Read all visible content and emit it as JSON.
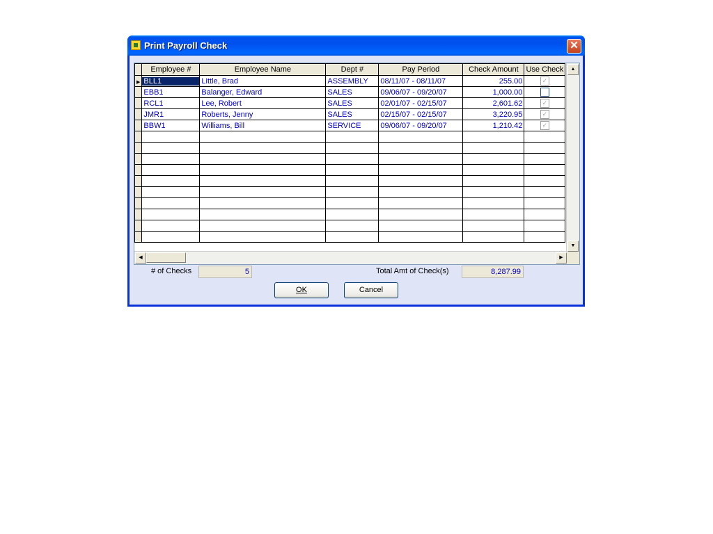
{
  "window": {
    "title": "Print Payroll Check",
    "close_symbol": "✕"
  },
  "grid": {
    "columns": [
      "Employee #",
      "Employee Name",
      "Dept #",
      "Pay Period",
      "Check Amount",
      "Use Check"
    ],
    "rows": [
      {
        "emp": "BLL1",
        "name": "Little, Brad",
        "dept": "ASSEMBLY",
        "period": "08/11/07 - 08/11/07",
        "amount": "255.00",
        "use": true
      },
      {
        "emp": "EBB1",
        "name": "Balanger, Edward",
        "dept": "SALES",
        "period": "09/06/07 - 09/20/07",
        "amount": "1,000.00",
        "use": false
      },
      {
        "emp": "RCL1",
        "name": "Lee, Robert",
        "dept": "SALES",
        "period": "02/01/07 - 02/15/07",
        "amount": "2,601.62",
        "use": true
      },
      {
        "emp": "JMR1",
        "name": "Roberts, Jenny",
        "dept": "SALES",
        "period": "02/15/07 - 02/15/07",
        "amount": "3,220.95",
        "use": true
      },
      {
        "emp": "BBW1",
        "name": "Williams, Bill",
        "dept": "SERVICE",
        "period": "09/06/07 - 09/20/07",
        "amount": "1,210.42",
        "use": true
      }
    ]
  },
  "footer": {
    "checks_label": "# of Checks",
    "checks_value": "5",
    "total_label": "Total Amt of Check(s)",
    "total_value": "8,287.99"
  },
  "buttons": {
    "ok_label": "OK",
    "cancel_label": "Cancel"
  }
}
